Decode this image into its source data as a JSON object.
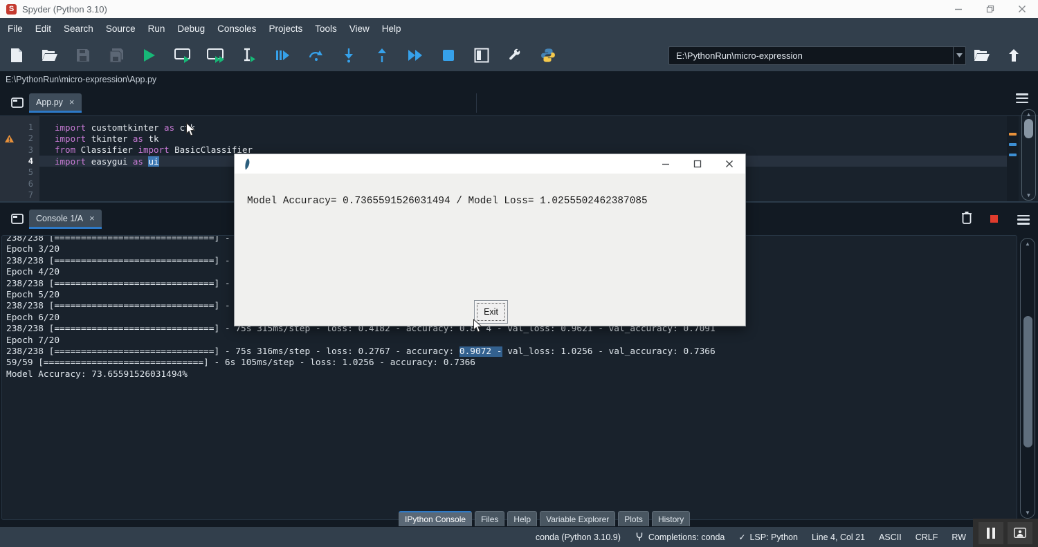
{
  "window": {
    "title": "Spyder (Python 3.10)"
  },
  "menubar": {
    "items": [
      "File",
      "Edit",
      "Search",
      "Source",
      "Run",
      "Debug",
      "Consoles",
      "Projects",
      "Tools",
      "View",
      "Help"
    ]
  },
  "toolbar": {
    "working_dir": "E:\\PythonRun\\micro-expression",
    "icon_names": [
      "new-file",
      "open-file",
      "save",
      "save-all",
      "run-file",
      "run-cell",
      "run-cell-advance",
      "run-selection",
      "debug-file",
      "step-over",
      "step-into",
      "step-return",
      "continue",
      "stop",
      "maximize-pane",
      "preferences-wrench",
      "python-env",
      "browse-working-directory",
      "parent-directory"
    ]
  },
  "breadcrumb": {
    "path": "E:\\PythonRun\\micro-expression\\App.py"
  },
  "icons": {
    "close": "×",
    "scroll_up": "▲",
    "scroll_down": "▼"
  },
  "editor": {
    "tab_label": "App.py",
    "lines": [
      {
        "n": "1",
        "segs": [
          [
            "kw",
            "import "
          ],
          [
            "id",
            "customtkinter "
          ],
          [
            "kw",
            "as "
          ],
          [
            "id",
            "ctk"
          ]
        ]
      },
      {
        "n": "2",
        "warning": true,
        "segs": [
          [
            "kw",
            "import "
          ],
          [
            "id",
            "tkinter "
          ],
          [
            "kw",
            "as "
          ],
          [
            "id",
            "tk"
          ]
        ]
      },
      {
        "n": "3",
        "segs": [
          [
            "kw",
            "from "
          ],
          [
            "id",
            "Classifier "
          ],
          [
            "kw",
            "import "
          ],
          [
            "id",
            "BasicClassifier"
          ]
        ]
      },
      {
        "n": "4",
        "current": true,
        "segs": [
          [
            "kw",
            "import "
          ],
          [
            "id",
            "easygui "
          ],
          [
            "kw",
            "as "
          ],
          [
            "sel",
            "ui"
          ]
        ]
      },
      {
        "n": "5",
        "segs": []
      },
      {
        "n": "6",
        "segs": []
      },
      {
        "n": "7",
        "segs": []
      }
    ]
  },
  "console": {
    "tab_label": "Console 1/A",
    "lines": [
      [
        [
          "p",
          "238/238 [==============================] -"
        ]
      ],
      [
        [
          "p",
          "Epoch 3/20"
        ]
      ],
      [
        [
          "p",
          "238/238 [==============================] -"
        ]
      ],
      [
        [
          "p",
          "Epoch 4/20"
        ]
      ],
      [
        [
          "p",
          "238/238 [==============================] -"
        ]
      ],
      [
        [
          "p",
          "Epoch 5/20"
        ]
      ],
      [
        [
          "p",
          "238/238 [==============================] -"
        ]
      ],
      [
        [
          "p",
          "Epoch 6/20"
        ]
      ],
      [
        [
          "p",
          "238/238 [==============================] - 75s 315ms/step - loss: 0.4182 - accuracy: 0.8"
        ],
        [
          "gap",
          ""
        ],
        [
          "p",
          "4 - val_loss: 0.9621 - val_accuracy: 0.7091"
        ]
      ],
      [
        [
          "p",
          "Epoch 7/20"
        ]
      ],
      [
        [
          "p",
          "238/238 [==============================] - 75s 316ms/step - loss: 0.2767 - accuracy: "
        ],
        [
          "sel",
          "0.9072 -"
        ],
        [
          "p",
          " val_loss: 1.0256 - val_accuracy: 0.7366"
        ]
      ],
      [
        [
          "p",
          "59/59 [==============================] - 6s 105ms/step - loss: 1.0256 - accuracy: 0.7366"
        ]
      ],
      [
        [
          "p",
          "Model Accuracy: 73.65591526031494%"
        ]
      ]
    ]
  },
  "dialog": {
    "message": "Model Accuracy= 0.7365591526031494 / Model Loss= 1.0255502462387085",
    "exit_label": "Exit"
  },
  "bottom_tabs": {
    "items": [
      {
        "label": "IPython Console",
        "active": true
      },
      {
        "label": "Files",
        "active": false
      },
      {
        "label": "Help",
        "active": false
      },
      {
        "label": "Variable Explorer",
        "active": false
      },
      {
        "label": "Plots",
        "active": false
      },
      {
        "label": "History",
        "active": false
      }
    ]
  },
  "statusbar": {
    "interpreter": "conda (Python 3.10.9)",
    "completions": "Completions: conda",
    "lsp_check": "✓",
    "lsp": "LSP: Python",
    "cursor": "Line 4, Col 21",
    "encoding": "ASCII",
    "eol": "CRLF",
    "permissions": "RW"
  },
  "colors": {
    "menubar_bg": "#323f4c",
    "editor_bg": "#19222c",
    "gutter_bg": "#28303b",
    "keyword": "#c97bd6",
    "selection": "#3e7ab5",
    "tab_underline": "#2d79c7",
    "run_green": "#17b877",
    "debug_blue": "#36a1ea",
    "warning_orange": "#e8913a",
    "console_selection": "#33618f",
    "dialog_bg": "#f0f0ee"
  }
}
